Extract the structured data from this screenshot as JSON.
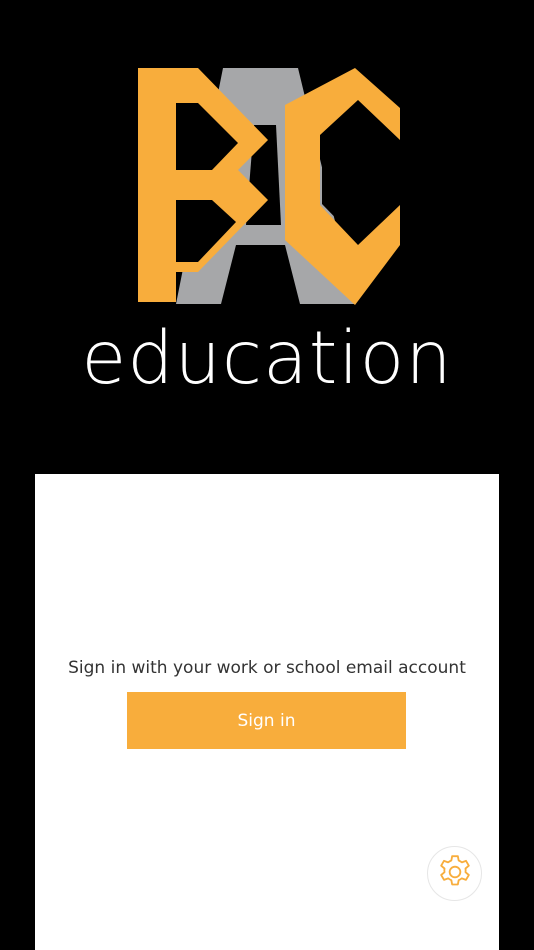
{
  "logo": {
    "wordmark": "education",
    "colors": {
      "primary": "#f8ad3c",
      "secondary": "#a6a7a9",
      "text": "#ffffff"
    }
  },
  "card": {
    "prompt": "Sign in with your work or school email account",
    "sign_in_label": "Sign in"
  },
  "settings": {
    "icon": "gear-icon"
  },
  "colors": {
    "accent": "#f8ad3c",
    "background": "#000000",
    "card": "#ffffff"
  }
}
